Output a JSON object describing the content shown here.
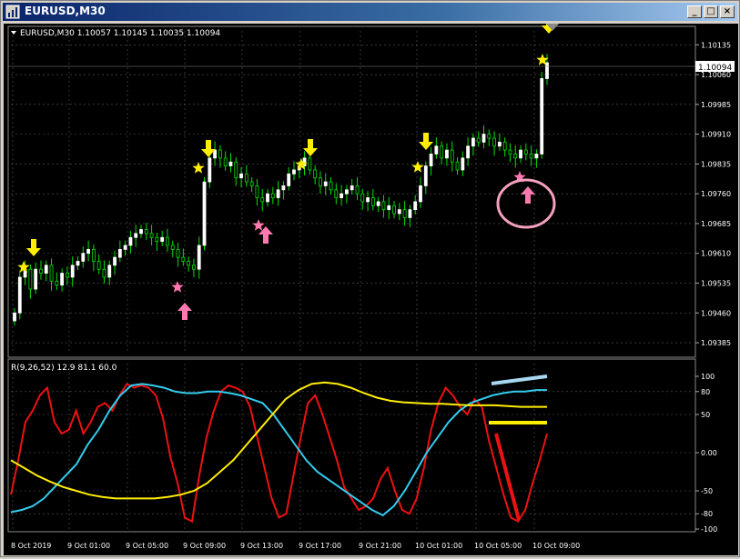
{
  "window": {
    "title": "EURUSD,M30",
    "buttons": [
      "minimize-button",
      "maximize-button",
      "close-button"
    ]
  },
  "header": {
    "symbol_info": "EURUSD,M30  1.10057 1.10145 1.10035 1.10094"
  },
  "current_price": "1.10094",
  "price_axis": [
    "1.10135",
    "1.10060",
    "1.09985",
    "1.09910",
    "1.09835",
    "1.09760",
    "1.09685",
    "1.09610",
    "1.09535",
    "1.09460",
    "1.09385"
  ],
  "indicator": {
    "label": "R(9,26,52) 12.9 81.1 60.0",
    "levels": [
      "100",
      "80",
      "50",
      "0.00",
      "-50",
      "-80",
      "-100"
    ]
  },
  "time_axis": [
    "8 Oct 2019",
    "9 Oct 01:00",
    "9 Oct 05:00",
    "9 Oct 09:00",
    "9 Oct 13:00",
    "9 Oct 17:00",
    "9 Oct 21:00",
    "10 Oct 01:00",
    "10 Oct 05:00",
    "10 Oct 09:00"
  ],
  "colors": {
    "background": "#000000",
    "bull_candle": "#ffffff",
    "bear_candle": "#00e000",
    "wick": "#00e000",
    "signal_sell": "#ffee00",
    "signal_buy": "#ff79b0",
    "line_fast": "#ee1111",
    "line_mid": "#33ccee",
    "line_slow": "#ffee00",
    "grid": "#5a5a5a"
  },
  "chart_data": [
    {
      "type": "candlestick",
      "title": "EURUSD,M30",
      "ylim": [
        1.0936,
        1.1017
      ],
      "x_ticks": [
        "8 Oct 2019",
        "9 Oct 01:00",
        "9 Oct 05:00",
        "9 Oct 09:00",
        "9 Oct 13:00",
        "9 Oct 17:00",
        "9 Oct 21:00",
        "10 Oct 01:00",
        "10 Oct 05:00",
        "10 Oct 09:00"
      ],
      "close": [
        1.0946,
        1.0955,
        1.0957,
        1.0952,
        1.0957,
        1.0956,
        1.0958,
        1.0954,
        1.0953,
        1.0956,
        1.0955,
        1.0958,
        1.0959,
        1.0961,
        1.0962,
        1.0959,
        1.0957,
        1.0955,
        1.0958,
        1.096,
        1.0962,
        1.0963,
        1.0965,
        1.0966,
        1.0967,
        1.0966,
        1.0965,
        1.0964,
        1.0965,
        1.0963,
        1.0962,
        1.096,
        1.0959,
        1.0958,
        1.0957,
        1.0963,
        1.0979,
        1.0985,
        1.0987,
        1.0985,
        1.0983,
        1.0984,
        1.098,
        1.0981,
        1.0979,
        1.0978,
        1.0975,
        1.0974,
        1.0976,
        1.0975,
        1.0977,
        1.0978,
        1.0981,
        1.0982,
        1.0983,
        1.0985,
        1.0982,
        1.098,
        1.0978,
        1.0979,
        1.0977,
        1.0975,
        1.0976,
        1.0977,
        1.0978,
        1.0976,
        1.0974,
        1.0975,
        1.0973,
        1.0974,
        1.0972,
        1.0973,
        1.0971,
        1.0972,
        1.097,
        1.0972,
        1.0974,
        1.0978,
        1.0983,
        1.0986,
        1.0988,
        1.0985,
        1.0987,
        1.0984,
        1.0982,
        1.0985,
        1.0988,
        1.099,
        1.0989,
        1.0991,
        1.099,
        1.0988,
        1.0989,
        1.0987,
        1.0986,
        1.0985,
        1.0987,
        1.0986,
        1.0985,
        1.0986,
        1.1005,
        1.1009
      ],
      "ylabel": "",
      "xlabel": "",
      "grid": true
    },
    {
      "type": "line",
      "title": "R(9,26,52) 12.9 81.1 60.0",
      "ylim": [
        -100,
        100
      ],
      "y_ticks": [
        100,
        80,
        50,
        0,
        -50,
        -80,
        -100
      ],
      "series": [
        {
          "name": "",
          "color": "#ee1111",
          "values": [
            -55,
            -10,
            40,
            55,
            75,
            85,
            40,
            25,
            30,
            55,
            25,
            40,
            60,
            65,
            55,
            75,
            90,
            85,
            88,
            85,
            75,
            45,
            -5,
            -40,
            -85,
            -90,
            -30,
            20,
            55,
            80,
            88,
            85,
            80,
            60,
            20,
            -20,
            -60,
            -85,
            -80,
            -30,
            20,
            65,
            75,
            50,
            20,
            -10,
            -45,
            -60,
            -75,
            -70,
            -60,
            -35,
            -20,
            -50,
            -75,
            -80,
            -60,
            -20,
            30,
            65,
            85,
            75,
            60,
            50,
            70,
            60,
            15,
            -20,
            -55,
            -85,
            -90,
            -75,
            -40,
            -10,
            25
          ],
          "note": ""
        },
        {
          "name": "",
          "color": "#33ccee",
          "values": [
            -78,
            -75,
            -70,
            -60,
            -45,
            -30,
            -15,
            10,
            30,
            55,
            75,
            88,
            90,
            88,
            85,
            80,
            78,
            78,
            80,
            80,
            78,
            75,
            70,
            65,
            50,
            30,
            10,
            -10,
            -25,
            -35,
            -45,
            -55,
            -65,
            -75,
            -82,
            -70,
            -50,
            -25,
            0,
            20,
            40,
            55,
            65,
            70,
            75,
            78,
            80,
            80,
            82,
            82
          ],
          "note": ""
        },
        {
          "name": "",
          "color": "#ffee00",
          "values": [
            -10,
            -20,
            -30,
            -38,
            -45,
            -50,
            -55,
            -58,
            -60,
            -60,
            -60,
            -60,
            -58,
            -55,
            -50,
            -40,
            -25,
            -10,
            10,
            30,
            50,
            70,
            82,
            90,
            92,
            90,
            85,
            78,
            72,
            68,
            66,
            65,
            64,
            64,
            63,
            62,
            62,
            62,
            61,
            60,
            60,
            60
          ],
          "note": ""
        }
      ]
    }
  ]
}
